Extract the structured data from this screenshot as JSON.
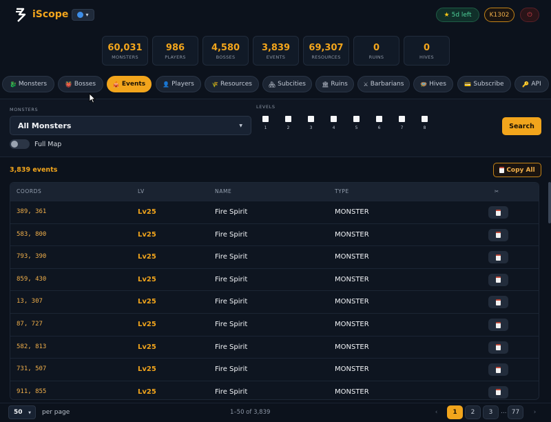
{
  "header": {
    "brand": "iScope",
    "lang_caret": "▾",
    "trial": "5d left",
    "kingdom": "K1302",
    "power_symbol": "⏻",
    "accent": "#f2a51c"
  },
  "stats": [
    {
      "value": "60,031",
      "label": "MONSTERS"
    },
    {
      "value": "986",
      "label": "PLAYERS"
    },
    {
      "value": "4,580",
      "label": "BOSSES"
    },
    {
      "value": "3,839",
      "label": "EVENTS"
    },
    {
      "value": "69,307",
      "label": "RESOURCES"
    },
    {
      "value": "0",
      "label": "RUINS"
    },
    {
      "value": "0",
      "label": "HIVES"
    }
  ],
  "tabs": [
    {
      "label": "Monsters",
      "icon": "🐉"
    },
    {
      "label": "Bosses",
      "icon": "👹"
    },
    {
      "label": "Events",
      "icon": "🎪",
      "active": true
    },
    {
      "label": "Players",
      "icon": "👤"
    },
    {
      "label": "Resources",
      "icon": "🌾"
    },
    {
      "label": "Subcities",
      "icon": "🏘"
    },
    {
      "label": "Ruins",
      "icon": "🏛"
    },
    {
      "label": "Barbarians",
      "icon": "⚔"
    },
    {
      "label": "Hives",
      "icon": "🪺"
    },
    {
      "label": "Subscribe",
      "icon": "💳"
    },
    {
      "label": "API",
      "icon": "🔑"
    }
  ],
  "filters": {
    "monsters_label": "MONSTERS",
    "monsters_value": "All Monsters",
    "full_map_label": "Full Map",
    "levels_label": "LEVELS",
    "levels": [
      "1",
      "2",
      "3",
      "4",
      "5",
      "6",
      "7",
      "8"
    ],
    "search_label": "Search"
  },
  "results": {
    "count_text": "3,839 events",
    "copy_all_label": "Copy All"
  },
  "table": {
    "columns": [
      "COORDS",
      "LV",
      "NAME",
      "TYPE",
      "✂"
    ],
    "rows": [
      {
        "coords": "389, 361",
        "lv": "Lv25",
        "name": "Fire Spirit",
        "type": "MONSTER"
      },
      {
        "coords": "583, 800",
        "lv": "Lv25",
        "name": "Fire Spirit",
        "type": "MONSTER"
      },
      {
        "coords": "793, 390",
        "lv": "Lv25",
        "name": "Fire Spirit",
        "type": "MONSTER"
      },
      {
        "coords": "859, 430",
        "lv": "Lv25",
        "name": "Fire Spirit",
        "type": "MONSTER"
      },
      {
        "coords": "13, 307",
        "lv": "Lv25",
        "name": "Fire Spirit",
        "type": "MONSTER"
      },
      {
        "coords": "87, 727",
        "lv": "Lv25",
        "name": "Fire Spirit",
        "type": "MONSTER"
      },
      {
        "coords": "582, 813",
        "lv": "Lv25",
        "name": "Fire Spirit",
        "type": "MONSTER"
      },
      {
        "coords": "731, 507",
        "lv": "Lv25",
        "name": "Fire Spirit",
        "type": "MONSTER"
      },
      {
        "coords": "911, 855",
        "lv": "Lv25",
        "name": "Fire Spirit",
        "type": "MONSTER"
      }
    ]
  },
  "pagination": {
    "per_page_value": "50",
    "per_page_label": "per page",
    "range_text": "1–50 of 3,839",
    "prev": "‹",
    "pages": [
      "1",
      "2",
      "3"
    ],
    "ellipsis": "...",
    "last": "77",
    "next": "›"
  }
}
